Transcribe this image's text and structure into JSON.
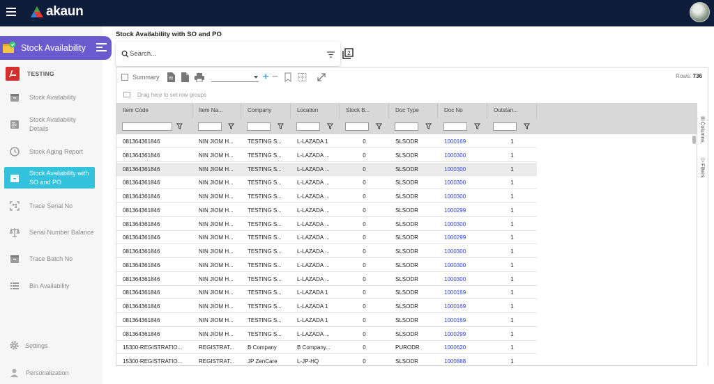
{
  "app": {
    "brand": "akaun"
  },
  "sidebar": {
    "title": "Stock Availability",
    "org": "TESTING",
    "items": [
      {
        "label": "Stock Availability",
        "icon": "inventory-box-icon"
      },
      {
        "label": "Stock Availability Details",
        "icon": "details-list-icon"
      },
      {
        "label": "Stock Aging Report",
        "icon": "clock-icon"
      },
      {
        "label": "Stock Availability with SO and PO",
        "icon": "inventory-box-icon",
        "active": true
      },
      {
        "label": "Trace Serial No",
        "icon": "qr-scan-icon"
      },
      {
        "label": "Serial Number Balance",
        "icon": "balance-scale-icon"
      },
      {
        "label": "Trace Batch No",
        "icon": "inventory-box-icon"
      },
      {
        "label": "Bin Availability",
        "icon": "list-icon"
      }
    ],
    "settings": "Settings",
    "personalization": "Personalization"
  },
  "page": {
    "title": "Stock Availability with SO and PO",
    "search_placeholder": "Search..."
  },
  "grid": {
    "summary_label": "Summary",
    "rows_label": "Rows:",
    "rows_count": "736",
    "group_hint": "Drag here to set row groups",
    "side_columns": "Columns",
    "side_filters": "Filters",
    "columns": [
      "Item Code",
      "Item Na...",
      "Company",
      "Location",
      "Stock B...",
      "Doc Type",
      "Doc No",
      "Outstan..."
    ],
    "rows": [
      [
        "081364361846",
        "NIN JIOM H...",
        "TESTING S...",
        "L-LAZADA 1",
        "0",
        "SLSODR",
        "1000169",
        "1"
      ],
      [
        "081364361846",
        "NIN JIOM H...",
        "TESTING S...",
        "L-LAZADA ...",
        "0",
        "SLSODR",
        "1000300",
        "1"
      ],
      [
        "081364361846",
        "NIN JIOM H...",
        "TESTING S...",
        "L-LAZADA ...",
        "0",
        "SLSODR",
        "1000300",
        "1"
      ],
      [
        "081364361846",
        "NIN JIOM H...",
        "TESTING S...",
        "L-LAZADA ...",
        "0",
        "SLSODR",
        "1000300",
        "1"
      ],
      [
        "081364361846",
        "NIN JIOM H...",
        "TESTING S...",
        "L-LAZADA ...",
        "0",
        "SLSODR",
        "1000300",
        "1"
      ],
      [
        "081364361846",
        "NIN JIOM H...",
        "TESTING S...",
        "L-LAZADA ...",
        "0",
        "SLSODR",
        "1000299",
        "1"
      ],
      [
        "081364361846",
        "NIN JIOM H...",
        "TESTING S...",
        "L-LAZADA ...",
        "0",
        "SLSODR",
        "1000300",
        "1"
      ],
      [
        "081364361846",
        "NIN JIOM H...",
        "TESTING S...",
        "L-LAZADA ...",
        "0",
        "SLSODR",
        "1000299",
        "1"
      ],
      [
        "081364361846",
        "NIN JIOM H...",
        "TESTING S...",
        "L-LAZADA ...",
        "0",
        "SLSODR",
        "1000300",
        "1"
      ],
      [
        "081364361846",
        "NIN JIOM H...",
        "TESTING S...",
        "L-LAZADA ...",
        "0",
        "SLSODR",
        "1000300",
        "1"
      ],
      [
        "081364361846",
        "NIN JIOM H...",
        "TESTING S...",
        "L-LAZADA ...",
        "0",
        "SLSODR",
        "1000300",
        "1"
      ],
      [
        "081364361846",
        "NIN JIOM H...",
        "TESTING S...",
        "L-LAZADA 1",
        "0",
        "SLSODR",
        "1000169",
        "1"
      ],
      [
        "081364361846",
        "NIN JIOM H...",
        "TESTING S...",
        "L-LAZADA 1",
        "0",
        "SLSODR",
        "1000169",
        "1"
      ],
      [
        "081364361846",
        "NIN JIOM H...",
        "TESTING S...",
        "L-LAZADA 1",
        "0",
        "SLSODR",
        "1000169",
        "1"
      ],
      [
        "081364361846",
        "NIN JIOM H...",
        "TESTING S...",
        "L-LAZADA ...",
        "0",
        "SLSODR",
        "1000299",
        "1"
      ],
      [
        "15300-REGISTRATIO...",
        "REGISTRAT...",
        "B Company",
        "B Company...",
        "0",
        "PURODR",
        "1000620",
        "1"
      ],
      [
        "15300-REGISTRATIO...",
        "REGISTRAT...",
        "JP ZenCare",
        "L-JP-HQ",
        "0",
        "SLSODR",
        "1000888",
        "1"
      ]
    ],
    "selected_row": 2
  },
  "colors": {
    "topbar": "#0e1d3a",
    "accent_purple": "#6a5acd",
    "active_cyan": "#33c2dc",
    "link_blue": "#2a3fd8"
  }
}
